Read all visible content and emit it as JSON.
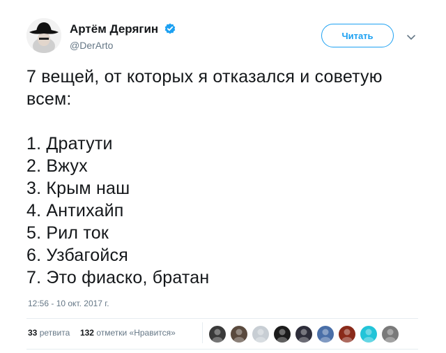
{
  "user": {
    "display_name": "Артём Дерягин",
    "handle": "@DerArto",
    "verified": true,
    "avatar_icon": "cowboy-hat-avatar"
  },
  "follow_button_label": "Читать",
  "tweet": {
    "lines": [
      "7 вещей, от которых я отказался и советую",
      "всем:",
      "",
      "1. Дратути",
      "2. Вжух",
      "3. Крым наш",
      "4. Антихайп",
      "5. Рил ток",
      "6. Узбагойся",
      "7. Это фиаско, братан"
    ],
    "timestamp": "12:56 - 10 окт. 2017 г."
  },
  "stats": {
    "retweets_count": "33",
    "retweets_label": "ретвита",
    "likes_count": "132",
    "likes_label": "отметки «Нравится»"
  },
  "likers": [
    {
      "color": "#3a3a3a"
    },
    {
      "color": "#5a4a3e"
    },
    {
      "color": "#c8ced4"
    },
    {
      "color": "#1b1b1b"
    },
    {
      "color": "#2d2d3a"
    },
    {
      "color": "#4a6fa8"
    },
    {
      "color": "#8a2a1a"
    },
    {
      "color": "#23c4d8"
    },
    {
      "color": "#7a7a7a"
    }
  ],
  "colors": {
    "accent": "#1da1f2",
    "muted": "#657786",
    "text": "#14171a"
  }
}
